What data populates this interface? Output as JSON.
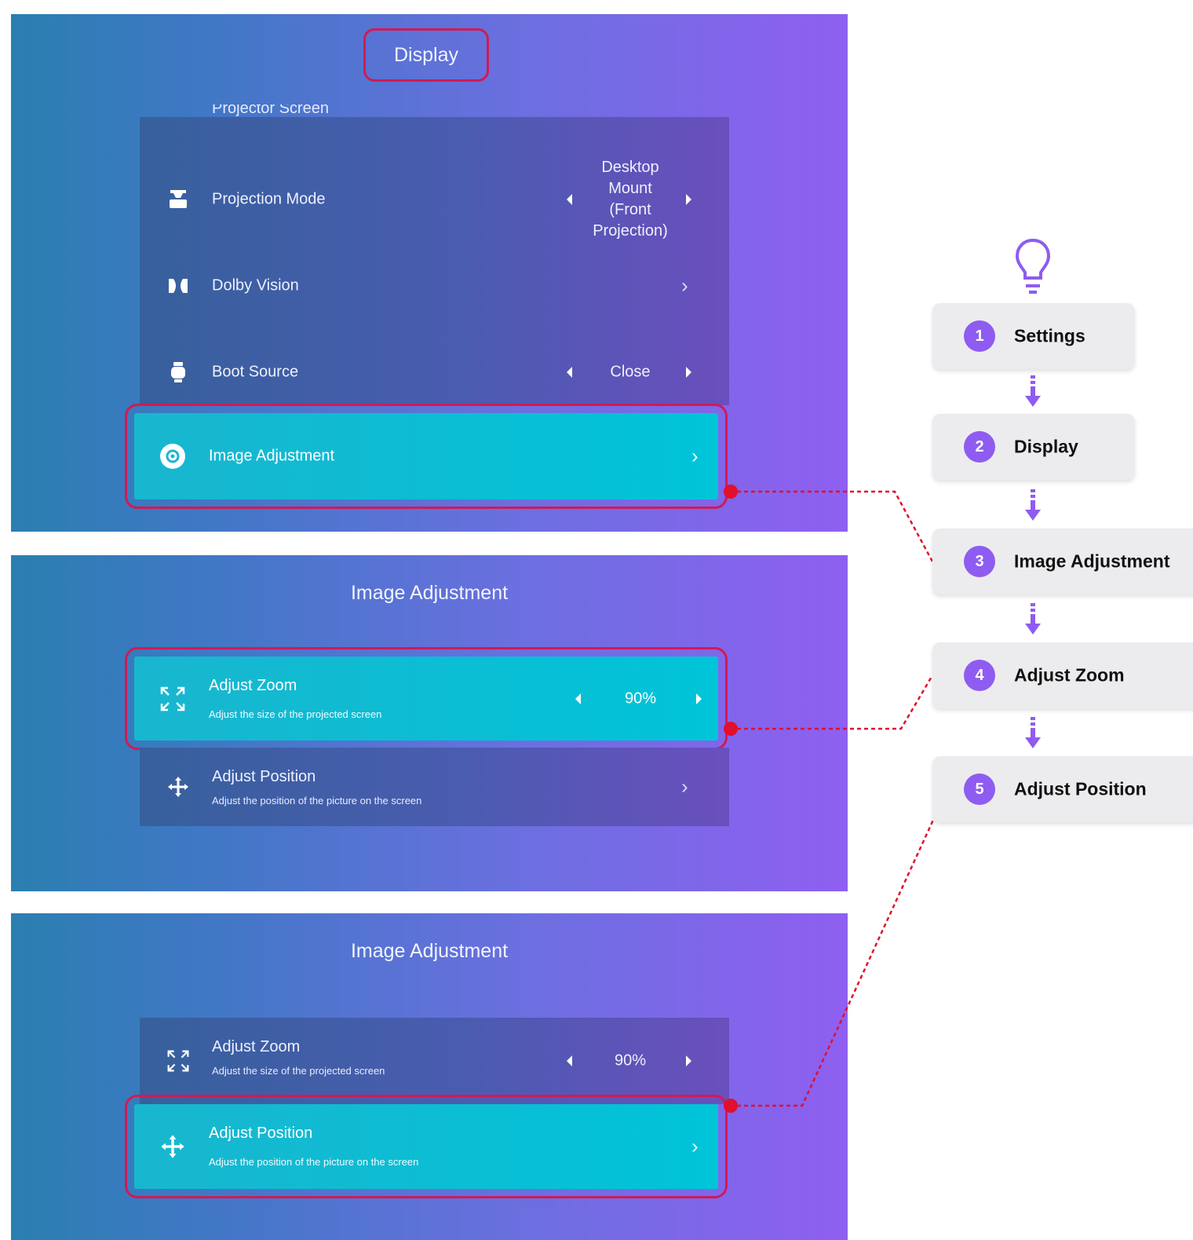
{
  "panels": [
    {
      "title": "Display",
      "partial_row_label": "Projector Screen",
      "rows": [
        {
          "label": "Projection Mode",
          "value": [
            "Desktop",
            "Mount",
            "(Front",
            "Projection)"
          ],
          "icon": "projector-icon"
        },
        {
          "label": "Dolby Vision",
          "icon": "dolby-icon"
        },
        {
          "label": "Boot Source",
          "value": "Close",
          "icon": "boot-source-icon"
        }
      ],
      "highlight": {
        "label": "Image Adjustment",
        "icon": "image-adjust-icon"
      }
    },
    {
      "title": "Image Adjustment",
      "highlight": {
        "label": "Adjust Zoom",
        "desc": "Adjust the size of the projected screen",
        "value": "90%",
        "icon": "zoom-icon"
      },
      "rows": [
        {
          "label": "Adjust Position",
          "desc": "Adjust the position of the picture on the screen",
          "icon": "move-icon"
        }
      ]
    },
    {
      "title": "Image Adjustment",
      "rows": [
        {
          "label": "Adjust Zoom",
          "desc": "Adjust the size of the projected screen",
          "value": "90%",
          "icon": "zoom-icon"
        }
      ],
      "highlight": {
        "label": "Adjust Position",
        "desc": "Adjust the position of the picture on the screen",
        "icon": "move-icon"
      }
    }
  ],
  "steps": [
    {
      "num": "1",
      "label": "Settings"
    },
    {
      "num": "2",
      "label": "Display"
    },
    {
      "num": "3",
      "label": "Image Adjustment"
    },
    {
      "num": "4",
      "label": "Adjust Zoom"
    },
    {
      "num": "5",
      "label": "Adjust Position"
    }
  ],
  "icons": {
    "tip": "lightbulb-icon",
    "step_arrow": "arrow-down-icon"
  },
  "colors": {
    "highlight_border": "#d01a56",
    "highlight_fill": "#00c4d8",
    "connector": "#e0102e",
    "step_badge": "#8e5cf0",
    "step_card": "#ececef"
  }
}
